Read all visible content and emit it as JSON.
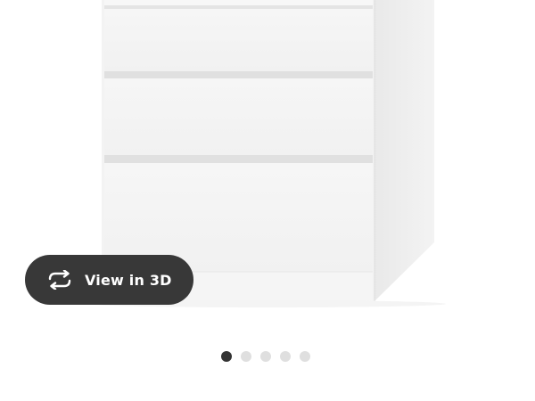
{
  "gallery": {
    "product_image_alt": "",
    "view_3d_label": "View in 3D",
    "view_3d_icon": "rotate-arrows-icon",
    "active_dot_index": 0,
    "dot_count": 5
  },
  "colors": {
    "button_bg": "#383838",
    "dot_active": "#333333",
    "dot_inactive": "#dfdfdf"
  }
}
